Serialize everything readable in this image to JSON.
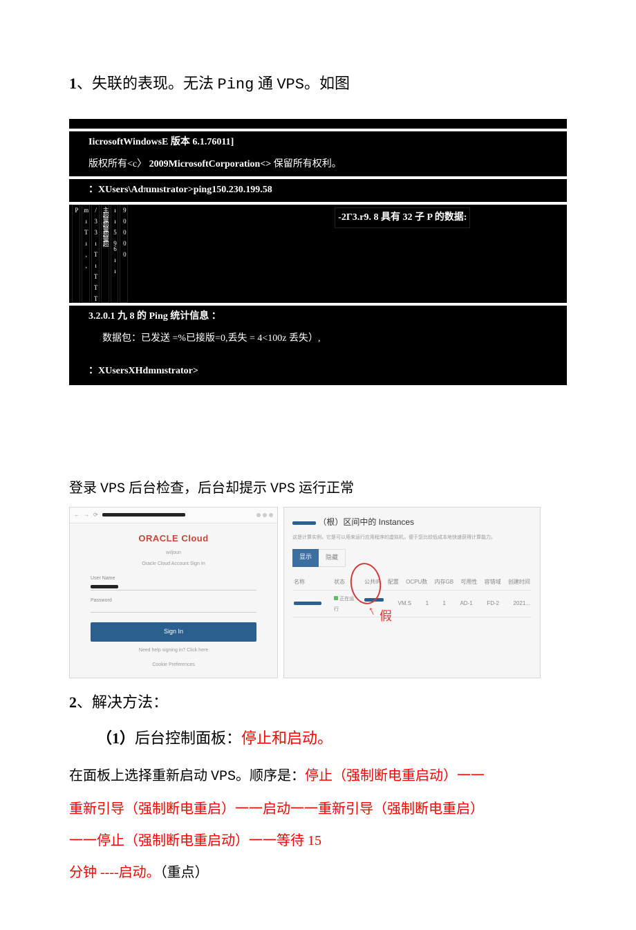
{
  "section1": {
    "num": "1",
    "title_a": "、失联的表现。",
    "title_b": "无法 ",
    "title_c": "Ping",
    "title_d": " 通 ",
    "title_e": "VPS",
    "title_f": "。如图"
  },
  "terminal": {
    "line1": "IicrosoftWindowsE 版本 6.1.76011]",
    "line2_a": "版权所有<c〉",
    "line2_b": "2009MicrosoftCorporation<>",
    "line2_c": "保留所有权利。",
    "line3": "：XUsers\\Adπınıstrator>ping150.230.199.58",
    "vcols": [
      "P",
      "m ı T ı , ,",
      "/ 3 3 ı T ı T T T",
      "主超量超量超量超",
      "ı ı 5 96 ı  ı",
      "9 0 0 0 0"
    ],
    "ping_header": "-2Γ3.r9. 8 具有 32 子 P 的数据:",
    "stats_a": "3.2.0.1 九 8 的 ",
    "stats_b": "Ping",
    "stats_c": " 统计信息 ：",
    "stats_line": "数据包：已发送 =%已接版=0,丢失 = 4<100z 丢失）,",
    "prompt2": "：XUsersXHdmnıstrator>"
  },
  "mid_text": {
    "a": "登录 ",
    "b": "VPS",
    "c": " 后台检查，后台却提示 ",
    "d": "VPS",
    "e": " 运行正常"
  },
  "oracle": {
    "logo_a": "ORACLE",
    "logo_b": " Cloud",
    "sub1": "wıljoun",
    "sub2": "Oracle Cloud Account Sign In",
    "user_label": "User Name",
    "pass_label": "Password",
    "signin": "Sign In",
    "help": "Need help signing in? Click here",
    "footer": "Cookie Preferences"
  },
  "instances": {
    "title_suffix": "（根）区间中的 Instances",
    "sub": "这是计算实例，它是可以用来运行应用程序的虚拟机，便于您比较低成本地快速获得计算能力。",
    "tab_active": "显示",
    "tab_inactive": "隐藏",
    "head": {
      "name": "名称",
      "state": "状态",
      "c3": "公共IP",
      "c4": "配置",
      "c5": "OCPU数",
      "c6": "内存GB",
      "c7": "可用性",
      "c8": "容错域",
      "c9": "创建时间"
    },
    "row": {
      "state": "正在运行",
      "v1": "VM.S",
      "v2": "1",
      "v3": "1",
      "v4": "AD-1",
      "v5": "FD-2",
      "v6": "2021..."
    },
    "annotation": "假"
  },
  "section2": {
    "num": "2",
    "title": "、解决方法：",
    "sub_num": "（1）",
    "sub_a": "后台控制面板：",
    "sub_b": "停止和启动。",
    "p1_a": "在面板上选择重新启动 ",
    "p1_b": "VPS",
    "p1_c": "。顺序是：",
    "p1_d": "停止（强制断电重启动）一一",
    "p2": "重新引导（强制断电重启）一一启动一一重新引导（强制断电重启）",
    "p3": "一一停止（强制断电重启动）一一等待 15",
    "p4_a": "分钟 ----启动。",
    "p4_b": "（重点）"
  }
}
